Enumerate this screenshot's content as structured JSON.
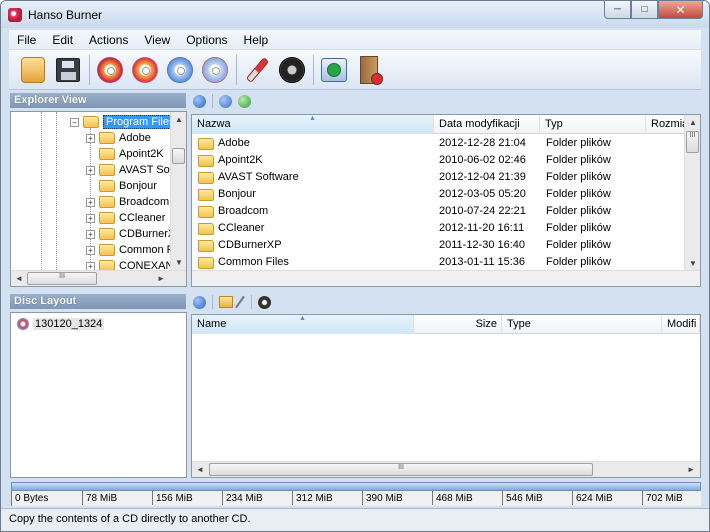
{
  "window": {
    "title": "Hanso Burner",
    "minimize": "─",
    "maximize": "□",
    "close": "✕"
  },
  "menu": [
    "File",
    "Edit",
    "Actions",
    "View",
    "Options",
    "Help"
  ],
  "toolbar": [
    "open-project-icon",
    "save-project-icon",
    "burn-disc-icon",
    "burn-image-icon",
    "copy-disc-icon",
    "erase-disc-icon",
    "clean-icon",
    "settings-icon",
    "update-icon",
    "exit-icon"
  ],
  "explorer": {
    "header": "Explorer View",
    "tree": [
      {
        "label": "Program Files",
        "expander": "−",
        "selected": true
      },
      {
        "label": "Adobe",
        "expander": "+"
      },
      {
        "label": "Apoint2K",
        "expander": ""
      },
      {
        "label": "AVAST Sof",
        "expander": "+"
      },
      {
        "label": "Bonjour",
        "expander": ""
      },
      {
        "label": "Broadcom",
        "expander": "+"
      },
      {
        "label": "CCleaner",
        "expander": "+"
      },
      {
        "label": "CDBurnerX",
        "expander": "+"
      },
      {
        "label": "Common F",
        "expander": "+"
      },
      {
        "label": "CONEXAN",
        "expander": "+"
      }
    ],
    "columns": [
      "Nazwa",
      "Data modyfikacji",
      "Typ",
      "Rozmia"
    ],
    "rows": [
      {
        "name": "Adobe",
        "date": "2012-12-28 21:04",
        "type": "Folder plików"
      },
      {
        "name": "Apoint2K",
        "date": "2010-06-02 02:46",
        "type": "Folder plików"
      },
      {
        "name": "AVAST Software",
        "date": "2012-12-04 21:39",
        "type": "Folder plików"
      },
      {
        "name": "Bonjour",
        "date": "2012-03-05 05:20",
        "type": "Folder plików"
      },
      {
        "name": "Broadcom",
        "date": "2010-07-24 22:21",
        "type": "Folder plików"
      },
      {
        "name": "CCleaner",
        "date": "2012-11-20 16:11",
        "type": "Folder plików"
      },
      {
        "name": "CDBurnerXP",
        "date": "2011-12-30 16:40",
        "type": "Folder plików"
      },
      {
        "name": "Common Files",
        "date": "2013-01-11 15:36",
        "type": "Folder plików"
      }
    ]
  },
  "disc": {
    "header": "Disc Layout",
    "tree_label": "130120_1324",
    "columns": [
      "Name",
      "Size",
      "Type",
      "Modifi"
    ]
  },
  "ruler": [
    "0 Bytes",
    "78 MiB",
    "156 MiB",
    "234 MiB",
    "312 MiB",
    "390 MiB",
    "468 MiB",
    "546 MiB",
    "624 MiB",
    "702 MiB"
  ],
  "scroll": {
    "grip": "III",
    "up": "▲",
    "down": "▼",
    "left": "◄",
    "right": "►"
  },
  "status": "Copy the contents of a CD directly to another CD.",
  "colors": {
    "accent": "#4a86c8",
    "panel_header": "#8aa2c0",
    "selected": "#3399ff"
  }
}
